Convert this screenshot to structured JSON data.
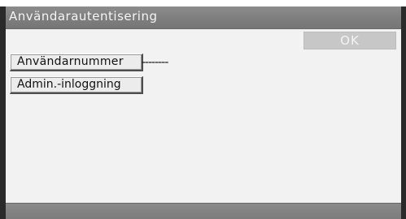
{
  "window": {
    "title": "Användarautentisering"
  },
  "toolbar": {
    "ok_label": "OK"
  },
  "fields": {
    "user_number_label": "Användarnummer",
    "user_number_value": "--------",
    "admin_login_label": "Admin.-inloggning"
  },
  "colors": {
    "title_bar": "#7d7d7d",
    "content_bg": "#f2f2f2",
    "bezel": "#2a2a2a",
    "ok_disabled_bg": "#c7c7c7"
  }
}
